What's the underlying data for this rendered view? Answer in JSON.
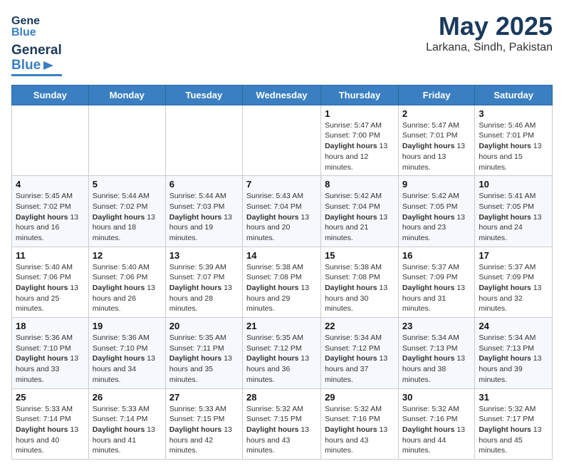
{
  "header": {
    "logo": {
      "general": "General",
      "blue": "Blue"
    },
    "month": "May 2025",
    "location": "Larkana, Sindh, Pakistan"
  },
  "weekdays": [
    "Sunday",
    "Monday",
    "Tuesday",
    "Wednesday",
    "Thursday",
    "Friday",
    "Saturday"
  ],
  "weeks": [
    [
      {
        "day": "",
        "info": ""
      },
      {
        "day": "",
        "info": ""
      },
      {
        "day": "",
        "info": ""
      },
      {
        "day": "",
        "info": ""
      },
      {
        "day": "1",
        "info": "Sunrise: 5:47 AM\nSunset: 7:00 PM\nDaylight: 13 hours and 12 minutes."
      },
      {
        "day": "2",
        "info": "Sunrise: 5:47 AM\nSunset: 7:01 PM\nDaylight: 13 hours and 13 minutes."
      },
      {
        "day": "3",
        "info": "Sunrise: 5:46 AM\nSunset: 7:01 PM\nDaylight: 13 hours and 15 minutes."
      }
    ],
    [
      {
        "day": "4",
        "info": "Sunrise: 5:45 AM\nSunset: 7:02 PM\nDaylight: 13 hours and 16 minutes."
      },
      {
        "day": "5",
        "info": "Sunrise: 5:44 AM\nSunset: 7:02 PM\nDaylight: 13 hours and 18 minutes."
      },
      {
        "day": "6",
        "info": "Sunrise: 5:44 AM\nSunset: 7:03 PM\nDaylight: 13 hours and 19 minutes."
      },
      {
        "day": "7",
        "info": "Sunrise: 5:43 AM\nSunset: 7:04 PM\nDaylight: 13 hours and 20 minutes."
      },
      {
        "day": "8",
        "info": "Sunrise: 5:42 AM\nSunset: 7:04 PM\nDaylight: 13 hours and 21 minutes."
      },
      {
        "day": "9",
        "info": "Sunrise: 5:42 AM\nSunset: 7:05 PM\nDaylight: 13 hours and 23 minutes."
      },
      {
        "day": "10",
        "info": "Sunrise: 5:41 AM\nSunset: 7:05 PM\nDaylight: 13 hours and 24 minutes."
      }
    ],
    [
      {
        "day": "11",
        "info": "Sunrise: 5:40 AM\nSunset: 7:06 PM\nDaylight: 13 hours and 25 minutes."
      },
      {
        "day": "12",
        "info": "Sunrise: 5:40 AM\nSunset: 7:06 PM\nDaylight: 13 hours and 26 minutes."
      },
      {
        "day": "13",
        "info": "Sunrise: 5:39 AM\nSunset: 7:07 PM\nDaylight: 13 hours and 28 minutes."
      },
      {
        "day": "14",
        "info": "Sunrise: 5:38 AM\nSunset: 7:08 PM\nDaylight: 13 hours and 29 minutes."
      },
      {
        "day": "15",
        "info": "Sunrise: 5:38 AM\nSunset: 7:08 PM\nDaylight: 13 hours and 30 minutes."
      },
      {
        "day": "16",
        "info": "Sunrise: 5:37 AM\nSunset: 7:09 PM\nDaylight: 13 hours and 31 minutes."
      },
      {
        "day": "17",
        "info": "Sunrise: 5:37 AM\nSunset: 7:09 PM\nDaylight: 13 hours and 32 minutes."
      }
    ],
    [
      {
        "day": "18",
        "info": "Sunrise: 5:36 AM\nSunset: 7:10 PM\nDaylight: 13 hours and 33 minutes."
      },
      {
        "day": "19",
        "info": "Sunrise: 5:36 AM\nSunset: 7:10 PM\nDaylight: 13 hours and 34 minutes."
      },
      {
        "day": "20",
        "info": "Sunrise: 5:35 AM\nSunset: 7:11 PM\nDaylight: 13 hours and 35 minutes."
      },
      {
        "day": "21",
        "info": "Sunrise: 5:35 AM\nSunset: 7:12 PM\nDaylight: 13 hours and 36 minutes."
      },
      {
        "day": "22",
        "info": "Sunrise: 5:34 AM\nSunset: 7:12 PM\nDaylight: 13 hours and 37 minutes."
      },
      {
        "day": "23",
        "info": "Sunrise: 5:34 AM\nSunset: 7:13 PM\nDaylight: 13 hours and 38 minutes."
      },
      {
        "day": "24",
        "info": "Sunrise: 5:34 AM\nSunset: 7:13 PM\nDaylight: 13 hours and 39 minutes."
      }
    ],
    [
      {
        "day": "25",
        "info": "Sunrise: 5:33 AM\nSunset: 7:14 PM\nDaylight: 13 hours and 40 minutes."
      },
      {
        "day": "26",
        "info": "Sunrise: 5:33 AM\nSunset: 7:14 PM\nDaylight: 13 hours and 41 minutes."
      },
      {
        "day": "27",
        "info": "Sunrise: 5:33 AM\nSunset: 7:15 PM\nDaylight: 13 hours and 42 minutes."
      },
      {
        "day": "28",
        "info": "Sunrise: 5:32 AM\nSunset: 7:15 PM\nDaylight: 13 hours and 43 minutes."
      },
      {
        "day": "29",
        "info": "Sunrise: 5:32 AM\nSunset: 7:16 PM\nDaylight: 13 hours and 43 minutes."
      },
      {
        "day": "30",
        "info": "Sunrise: 5:32 AM\nSunset: 7:16 PM\nDaylight: 13 hours and 44 minutes."
      },
      {
        "day": "31",
        "info": "Sunrise: 5:32 AM\nSunset: 7:17 PM\nDaylight: 13 hours and 45 minutes."
      }
    ]
  ]
}
